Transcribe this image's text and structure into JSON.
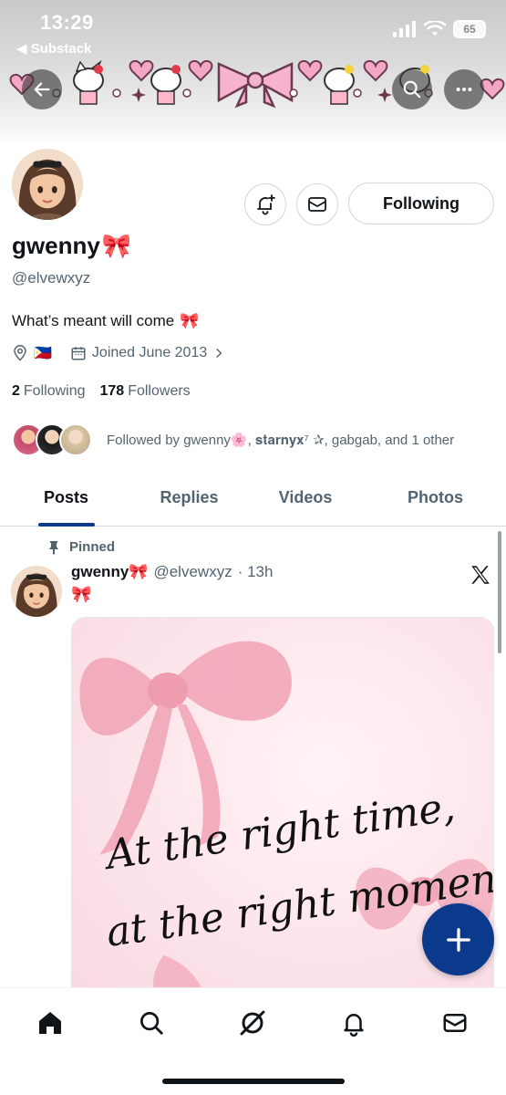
{
  "status_bar": {
    "time": "13:29",
    "back_label": "◀ Substack",
    "battery": "65"
  },
  "header": {
    "back_icon": "arrow-left-icon",
    "search_icon": "search-icon",
    "more_icon": "more-icon"
  },
  "profile": {
    "display_name": "gwenny",
    "name_emoji": "🎀",
    "handle": "@elvewxyz",
    "bio_text": "What’s meant will come",
    "bio_emoji": "🎀",
    "location_flag": "🇵🇭",
    "joined": "Joined June 2013",
    "following_count": "2",
    "following_label": "Following",
    "followers_count": "178",
    "followers_label": "Followers",
    "followed_by": "Followed by gwenny🌸, 𝐬𝐭𝐚𝐫𝐧𝐲𝐱⁷ ✰, gabgab, and 1 other",
    "follow_button_label": "Following"
  },
  "tabs": [
    {
      "label": "Posts",
      "active": true
    },
    {
      "label": "Replies",
      "active": false
    },
    {
      "label": "Videos",
      "active": false
    },
    {
      "label": "Photos",
      "active": false
    }
  ],
  "post": {
    "pinned_label": "Pinned",
    "author_name": "gwenny",
    "author_emoji": "🎀",
    "author_handle": "@elvewxyz",
    "time": "· 13h",
    "text": "🎀",
    "image_text_line1": "At the right time,",
    "image_text_line2": "at the right moment"
  },
  "fab_label": "+",
  "bottom_nav": [
    {
      "name": "home-icon",
      "active": true
    },
    {
      "name": "search-icon",
      "active": false
    },
    {
      "name": "grok-icon",
      "active": false
    },
    {
      "name": "bell-icon",
      "active": false
    },
    {
      "name": "mail-icon",
      "active": false
    }
  ],
  "colors": {
    "accent": "#0b3a8c",
    "text_primary": "#0f1419",
    "text_secondary": "#536471",
    "border": "#cfd9de",
    "bow_pink": "#f2a7b8"
  }
}
